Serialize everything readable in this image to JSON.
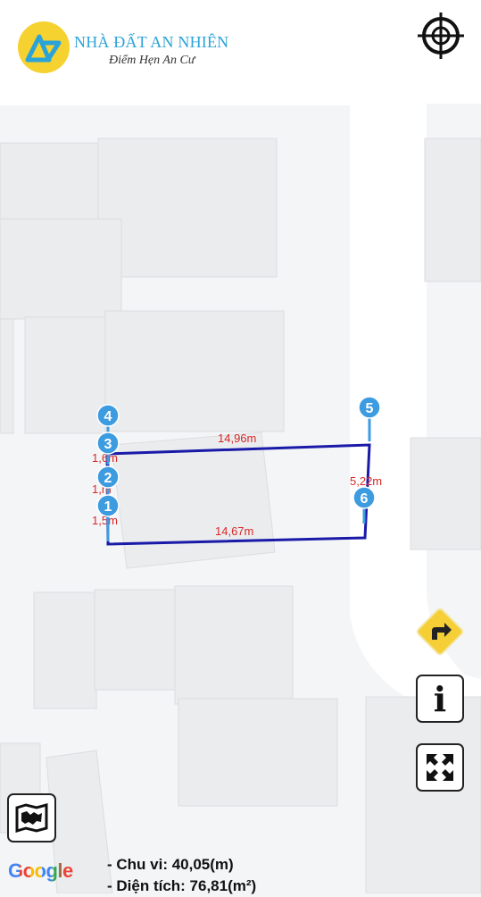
{
  "brand": {
    "title": "NHÀ ĐẤT AN NHIÊN",
    "slogan": "Điểm Hẹn An Cư",
    "primary_color": "#2aa3d8",
    "accent_color": "#f6d231"
  },
  "plot": {
    "line_color": "#1a1aa8",
    "marker_color": "#3d9be0",
    "label_color": "#d62828",
    "markers": [
      {
        "label": "1"
      },
      {
        "label": "2"
      },
      {
        "label": "3"
      },
      {
        "label": "4"
      },
      {
        "label": "5"
      },
      {
        "label": "6"
      }
    ],
    "edge_labels": {
      "top": "14,96m",
      "bottom": "14,67m",
      "right": "5,22m",
      "left_1": "1,6⁠m",
      "left_2": "1,​m",
      "left_3": "1,5⁠m"
    }
  },
  "controls": {
    "locate": "crosshair-icon",
    "direction": "turn-right-icon",
    "info": "i",
    "expand": "expand-icon",
    "map_type": "map-icon"
  },
  "attribution": "Google",
  "summary": {
    "perimeter": "- Chu vi: 40,05(m)",
    "area": "- Diện tích: 76,81(m²)"
  }
}
